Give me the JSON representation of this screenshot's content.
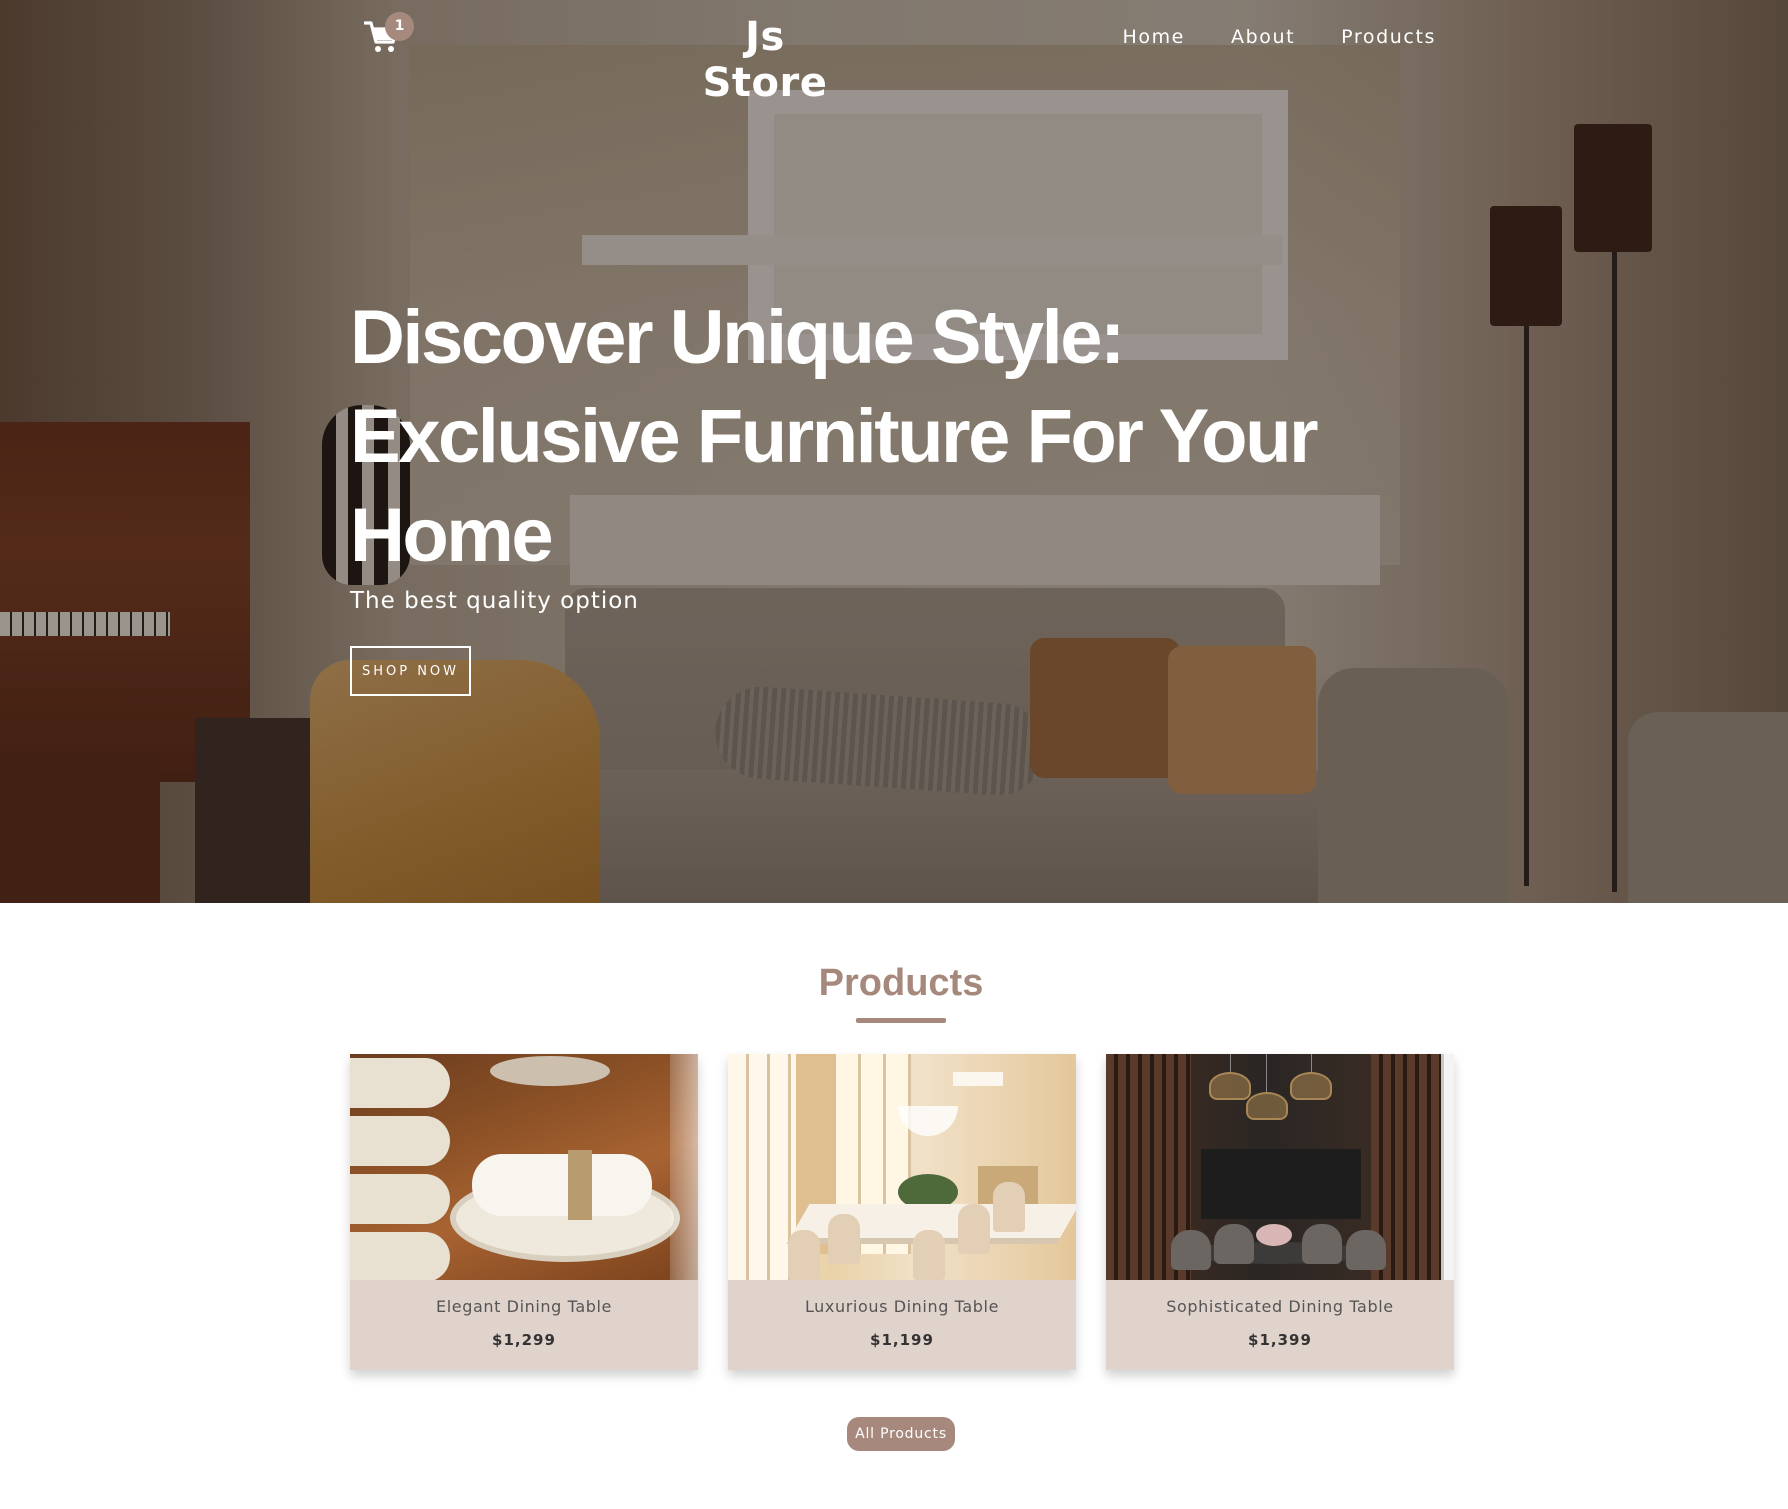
{
  "nav": {
    "cart_icon": "cart-icon",
    "cart_count": "1",
    "brand": "Js Store",
    "links": [
      "Home",
      "About",
      "Products"
    ]
  },
  "hero": {
    "title": "Discover Unique Style: Exclusive Furniture For Your Home",
    "subtitle": "The best quality option",
    "cta": "SHOP NOW"
  },
  "products_section": {
    "title": "Products",
    "items": [
      {
        "name": "Elegant Dining Table",
        "price": "$1,299"
      },
      {
        "name": "Luxurious Dining Table",
        "price": "$1,199"
      },
      {
        "name": "Sophisticated Dining Table",
        "price": "$1,399"
      }
    ],
    "all_button": "All Products"
  },
  "colors": {
    "accent": "#a7887d",
    "card_footer": "#e0d3cc",
    "hero_text": "#ffffff"
  }
}
